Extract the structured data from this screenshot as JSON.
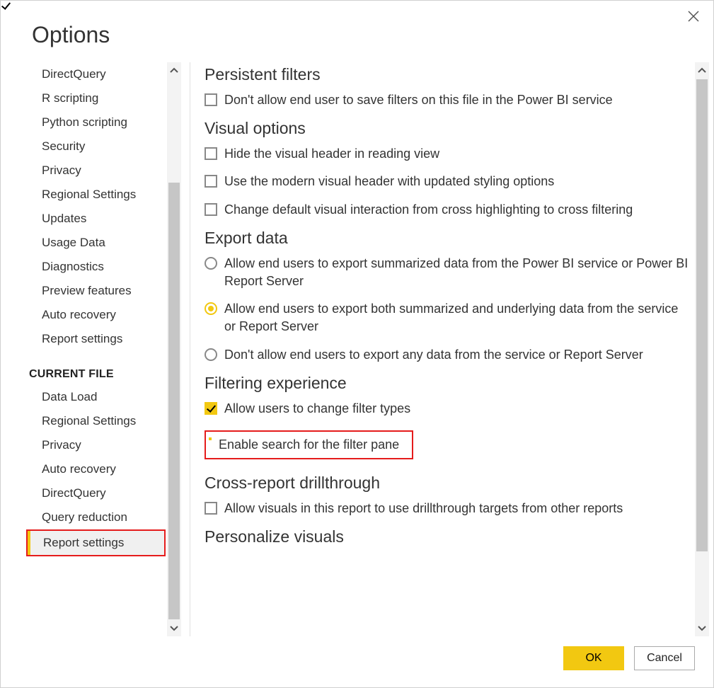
{
  "dialog": {
    "title": "Options",
    "footer": {
      "ok": "OK",
      "cancel": "Cancel"
    }
  },
  "sidebar": {
    "items": [
      {
        "label": "DirectQuery"
      },
      {
        "label": "R scripting"
      },
      {
        "label": "Python scripting"
      },
      {
        "label": "Security"
      },
      {
        "label": "Privacy"
      },
      {
        "label": "Regional Settings"
      },
      {
        "label": "Updates"
      },
      {
        "label": "Usage Data"
      },
      {
        "label": "Diagnostics"
      },
      {
        "label": "Preview features"
      },
      {
        "label": "Auto recovery"
      },
      {
        "label": "Report settings"
      }
    ],
    "section_header": "CURRENT FILE",
    "cf_items": [
      {
        "label": "Data Load"
      },
      {
        "label": "Regional Settings"
      },
      {
        "label": "Privacy"
      },
      {
        "label": "Auto recovery"
      },
      {
        "label": "DirectQuery"
      },
      {
        "label": "Query reduction"
      },
      {
        "label": "Report settings",
        "selected": true,
        "highlighted": true
      }
    ]
  },
  "content": {
    "sections": {
      "persistent": {
        "title": "Persistent filters",
        "cb1": "Don't allow end user to save filters on this file in the Power BI service"
      },
      "visual": {
        "title": "Visual options",
        "cb1": "Hide the visual header in reading view",
        "cb2": "Use the modern visual header with updated styling options",
        "cb3": "Change default visual interaction from cross highlighting to cross filtering"
      },
      "export": {
        "title": "Export data",
        "r1": "Allow end users to export summarized data from the Power BI service or Power BI Report Server",
        "r2": "Allow end users to export both summarized and underlying data from the service or Report Server",
        "r3": "Don't allow end users to export any data from the service or Report Server"
      },
      "filtering": {
        "title": "Filtering experience",
        "cb1": "Allow users to change filter types",
        "cb2": "Enable search for the filter pane"
      },
      "crossreport": {
        "title": "Cross-report drillthrough",
        "cb1": "Allow visuals in this report to use drillthrough targets from other reports"
      },
      "personalize": {
        "title": "Personalize visuals"
      }
    }
  }
}
